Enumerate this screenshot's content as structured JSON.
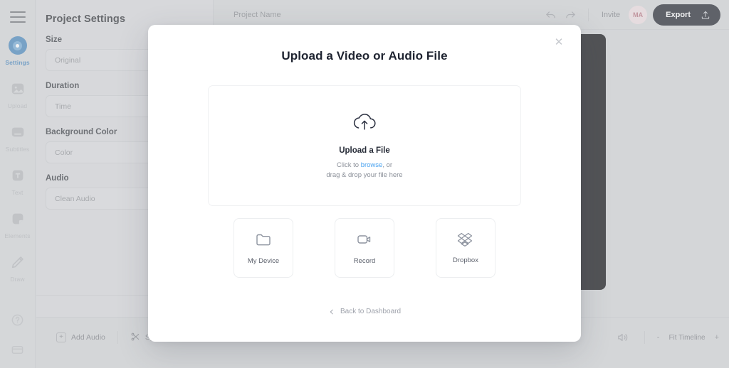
{
  "sidebar": {
    "menu_icon": "hamburger-icon",
    "items": [
      {
        "label": "Settings",
        "icon": "settings-target-icon",
        "active": true
      },
      {
        "label": "Upload",
        "icon": "image-upload-icon",
        "active": false
      },
      {
        "label": "Subtitles",
        "icon": "subtitles-icon",
        "active": false
      },
      {
        "label": "Text",
        "icon": "text-icon",
        "active": false
      },
      {
        "label": "Elements",
        "icon": "elements-icon",
        "active": false
      },
      {
        "label": "Draw",
        "icon": "pencil-draw-icon",
        "active": false
      }
    ],
    "bottom_items": [
      {
        "icon": "help-circle-icon"
      },
      {
        "icon": "billing-card-icon"
      }
    ],
    "active_color": "#1a8cf0"
  },
  "panel": {
    "title": "Project Settings",
    "fields": [
      {
        "label": "Size",
        "value": "Original"
      },
      {
        "label": "Duration",
        "value": "Time"
      },
      {
        "label": "Background Color",
        "value": "Color"
      },
      {
        "label": "Audio",
        "value": "Clean Audio"
      }
    ]
  },
  "topbar": {
    "project_name_placeholder": "Project Name",
    "undo_icon": "undo-arrow-icon",
    "redo_icon": "redo-arrow-icon",
    "invite_label": "Invite",
    "avatar_initials": "MA",
    "avatar_color": "#e2657c",
    "export_label": "Export",
    "export_icon": "upload-icon",
    "export_bg": "#1c2233"
  },
  "canvas": {
    "background_color": "#0a0b10"
  },
  "timeline": {
    "add_audio_label": "Add Audio",
    "add_audio_icon": "plus-box-icon",
    "split_label": "Split",
    "split_icon": "scissors-icon",
    "volume_icon": "speaker-icon",
    "zoom_out": "-",
    "fit_label": "Fit Timeline",
    "zoom_in": "+"
  },
  "modal": {
    "title": "Upload a Video or Audio File",
    "close_icon": "close-icon",
    "dropzone": {
      "icon": "cloud-upload-icon",
      "title": "Upload a File",
      "line1_prefix": "Click to ",
      "line1_link": "browse",
      "line1_suffix": ", or",
      "line2": "drag & drop your file here",
      "link_color": "#4aa3f0"
    },
    "options": [
      {
        "label": "My Device",
        "icon": "folder-icon"
      },
      {
        "label": "Record",
        "icon": "video-camera-icon"
      },
      {
        "label": "Dropbox",
        "icon": "dropbox-icon"
      }
    ],
    "back_label": "Back to Dashboard",
    "back_icon": "chevron-left-icon"
  }
}
